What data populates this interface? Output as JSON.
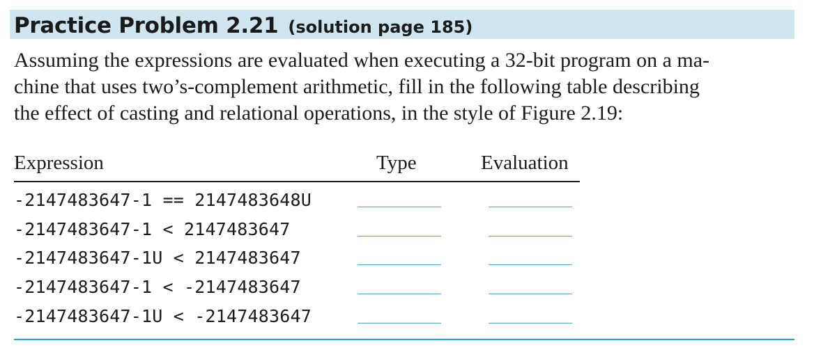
{
  "header": {
    "title": "Practice Problem 2.21",
    "solution_ref": "(solution page 185)"
  },
  "body": {
    "lines": [
      "Assuming the expressions are evaluated when executing a 32-bit program on a ma-",
      "chine that uses two’s-complement arithmetic, fill in the following table describing",
      "the effect of casting and relational operations, in the style of Figure 2.19:"
    ]
  },
  "table": {
    "columns": [
      "Expression",
      "Type",
      "Evaluation"
    ],
    "rows": [
      {
        "expression": "-2147483647-1 == 2147483648U",
        "type": "",
        "evaluation": ""
      },
      {
        "expression": "-2147483647-1 < 2147483647",
        "type": "",
        "evaluation": ""
      },
      {
        "expression": "-2147483647-1U < 2147483647",
        "type": "",
        "evaluation": ""
      },
      {
        "expression": "-2147483647-1 < -2147483647",
        "type": "",
        "evaluation": ""
      },
      {
        "expression": "-2147483647-1U < -2147483647",
        "type": "",
        "evaluation": ""
      }
    ]
  },
  "colors": {
    "header_background": "#cfe6f0",
    "answer_line": "#4aa8d6",
    "bottom_rule": "#2a9ed4",
    "text": "#1a1a1a"
  }
}
